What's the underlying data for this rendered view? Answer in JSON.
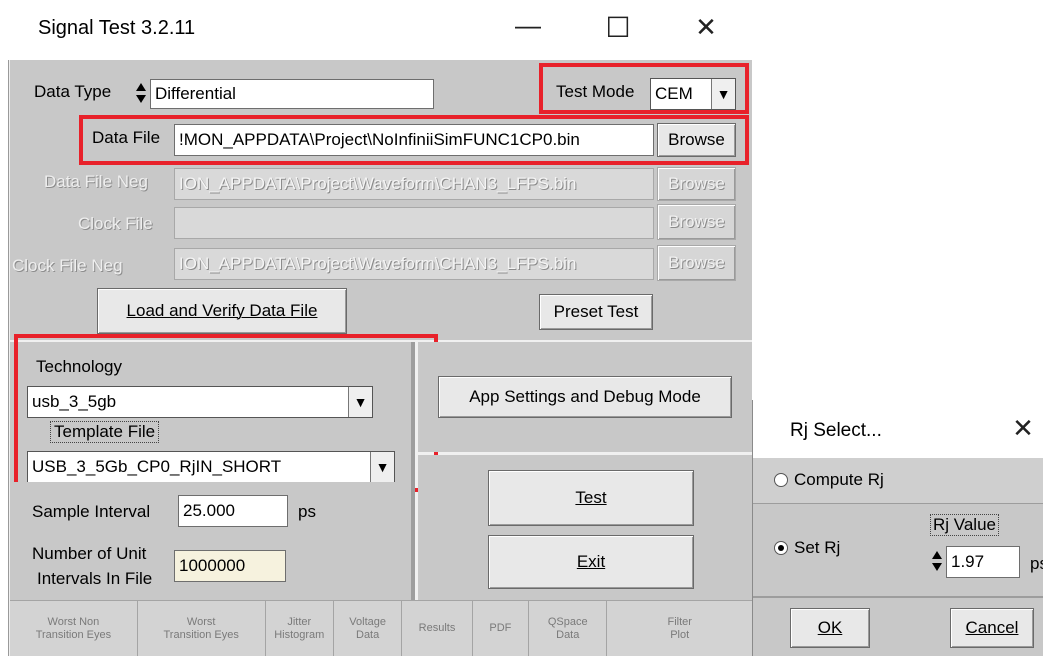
{
  "window": {
    "title": "Signal Test 3.2.11",
    "minimize_glyph": "—",
    "maximize_glyph": "☐",
    "close_glyph": "✕"
  },
  "data_type": {
    "label": "Data Type",
    "value": "Differential"
  },
  "test_mode": {
    "label": "Test Mode",
    "value": "CEM"
  },
  "files": {
    "data_file": {
      "label": "Data File",
      "value": "!MON_APPDATA\\Project\\NoInfiniiSimFUNC1CP0.bin",
      "browse": "Browse"
    },
    "data_file_neg": {
      "label": "Data File Neg",
      "value": "ION_APPDATA\\Project\\Waveform\\CHAN3_LFPS.bin",
      "browse": "Browse"
    },
    "clock_file": {
      "label": "Clock File",
      "value": "",
      "browse": "Browse"
    },
    "clock_file_neg": {
      "label": "Clock File Neg",
      "value": "ION_APPDATA\\Project\\Waveform\\CHAN3_LFPS.bin",
      "browse": "Browse"
    }
  },
  "buttons": {
    "load_verify": "Load and Verify Data File",
    "preset_test": "Preset Test",
    "app_settings": "App Settings and Debug Mode",
    "test": "Test",
    "exit": "Exit"
  },
  "technology": {
    "label": "Technology",
    "value": "usb_3_5gb",
    "template_label": "Template File",
    "template_value": "USB_3_5Gb_CP0_RjIN_SHORT"
  },
  "sampling": {
    "sample_interval_label": "Sample Interval",
    "sample_interval_value": "25.000",
    "sample_unit": "ps",
    "num_ui_label_1": "Number of Unit",
    "num_ui_label_2": "Intervals In File",
    "num_ui_value": "1000000"
  },
  "tabs": [
    {
      "l1": "Worst Non",
      "l2": "Transition Eyes"
    },
    {
      "l1": "Worst",
      "l2": "Transition Eyes"
    },
    {
      "l1": "Jitter",
      "l2": "Histogram"
    },
    {
      "l1": "Voltage",
      "l2": "Data"
    },
    {
      "l1": "Results",
      "l2": ""
    },
    {
      "l1": "PDF",
      "l2": ""
    },
    {
      "l1": "QSpace",
      "l2": "Data"
    },
    {
      "l1": "Filter",
      "l2": "Plot"
    }
  ],
  "rj_dialog": {
    "title": "Rj Select...",
    "close_glyph": "✕",
    "compute_label": "Compute Rj",
    "set_label": "Set Rj",
    "rj_value_label": "Rj Value",
    "rj_value": "1.97",
    "rj_unit": "ps",
    "ok": "OK",
    "cancel": "Cancel",
    "selected": "set"
  },
  "colors": {
    "highlight_red": "#e8212a",
    "panel_gray": "#c8c8c8"
  }
}
